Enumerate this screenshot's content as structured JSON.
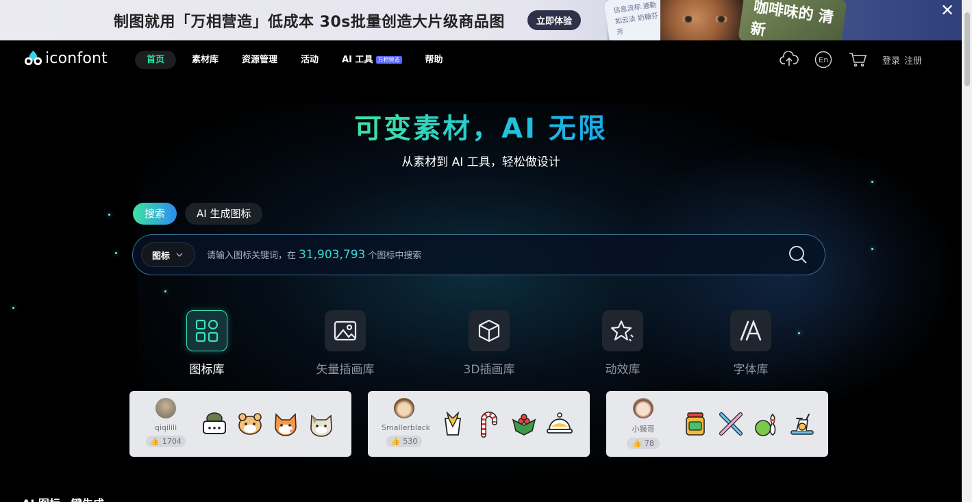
{
  "banner": {
    "text": "制图就用「万相营造」低成本 30s批量创造大片级商品图",
    "button": "立即体验",
    "card1_text": "信息流标 通勤如云淡 奶糖芬芳",
    "card2_text": "咖啡味的 清新"
  },
  "header": {
    "logo_text": "iconfont",
    "nav": [
      "首页",
      "素材库",
      "资源管理",
      "活动",
      "AI 工具",
      "帮助"
    ],
    "ai_badge": "万相营造",
    "lang": "En",
    "login": "登录",
    "register": "注册"
  },
  "hero": {
    "title": "可变素材，AI 无限",
    "subtitle": "从素材到 AI 工具，轻松做设计"
  },
  "search": {
    "tabs": [
      "搜索",
      "AI 生成图标"
    ],
    "type": "图标",
    "placeholder_prefix": "请输入图标关键词，在",
    "count": "31,903,793",
    "placeholder_suffix": "个图标中搜索"
  },
  "categories": [
    "图标库",
    "矢量插画库",
    "3D插画库",
    "动效库",
    "字体库"
  ],
  "cards": [
    {
      "name": "qiqilili",
      "likes": "1704"
    },
    {
      "name": "Smallerblack",
      "likes": "530"
    },
    {
      "name": "小猴哥",
      "likes": "78"
    }
  ],
  "section_title": "AI 图标一键生成",
  "colors": {
    "accent": "#25e39a",
    "search_count": "#3ad9d0",
    "card_bg": "#e7e8ec"
  }
}
